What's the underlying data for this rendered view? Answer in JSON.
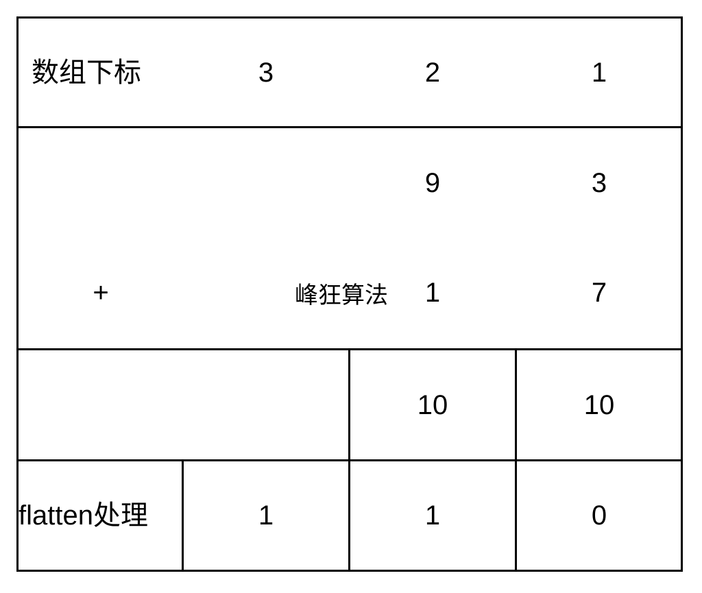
{
  "header_row": {
    "label": "数组下标",
    "indices": [
      "3",
      "2",
      "1"
    ]
  },
  "addend_row_1": {
    "values": [
      "9",
      "3"
    ]
  },
  "addend_row_2": {
    "operator": "+",
    "values": [
      "1",
      "7"
    ]
  },
  "sum_row": {
    "values": [
      "10",
      "10"
    ]
  },
  "flatten_row": {
    "label": "flatten处理",
    "values": [
      "1",
      "1",
      "0"
    ]
  },
  "watermark": "峰狂算法"
}
